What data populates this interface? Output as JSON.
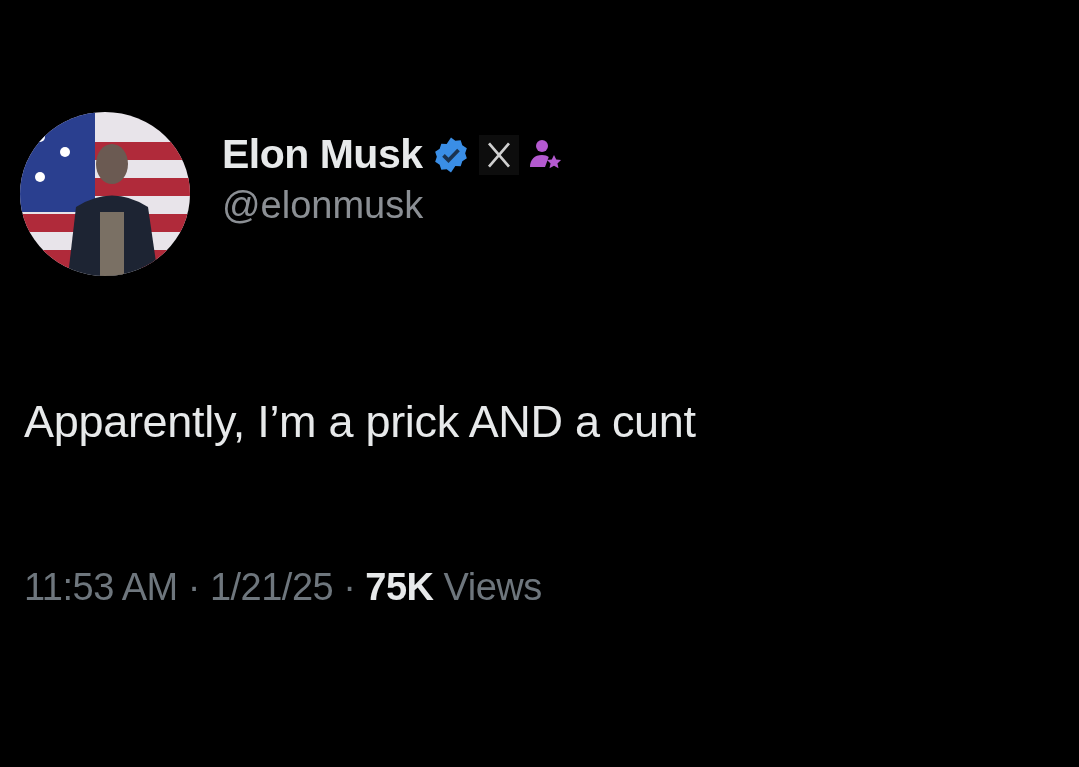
{
  "author": {
    "name": "Elon Musk",
    "verified": true,
    "handle": "@elonmusk"
  },
  "text": "Apparently, I’m a prick AND a cunt",
  "meta": {
    "time": "11:53 AM",
    "separator": "·",
    "date": "1/21/25",
    "separator_2": "·",
    "views_count": "75K",
    "views_label": "Views"
  }
}
